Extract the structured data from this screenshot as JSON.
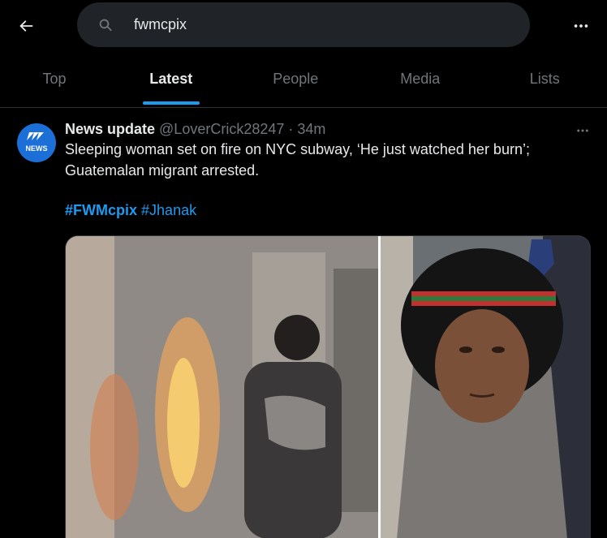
{
  "search": {
    "query": "fwmcpix"
  },
  "tabs": [
    {
      "label": "Top"
    },
    {
      "label": "Latest"
    },
    {
      "label": "People"
    },
    {
      "label": "Media"
    },
    {
      "label": "Lists"
    }
  ],
  "tweet": {
    "name": "News update",
    "handle": "@LoverCrick28247",
    "dot": "·",
    "time": "34m",
    "text": "Sleeping woman set on fire on NYC subway, ‘He just watched her burn’; Guatemalan migrant arrested.",
    "hashtags": [
      "#FWMcpix",
      "#Jhanak"
    ],
    "avatar_text": "NEWS"
  },
  "colors": {
    "accent": "#1d9bf0",
    "background": "#000000",
    "search_bg": "#202327"
  }
}
